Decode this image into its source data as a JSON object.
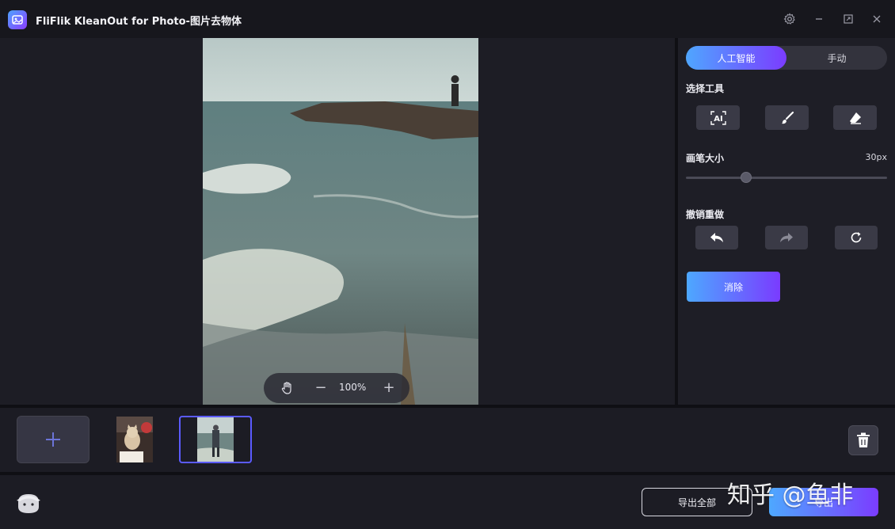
{
  "titlebar": {
    "title": "FliFlik KleanOut for Photo-图片去物体",
    "icons": [
      "settings-icon",
      "minimize-icon",
      "maximize-icon",
      "close-icon"
    ]
  },
  "canvas": {
    "zoom": {
      "hand_icon": "hand-icon",
      "minus": "−",
      "level": "100%",
      "plus": "+"
    }
  },
  "panel": {
    "mode_tabs": [
      {
        "label": "人工智能",
        "active": true
      },
      {
        "label": "手动",
        "active": false
      }
    ],
    "select_tool_label": "选择工具",
    "tools": [
      "ai-select-icon",
      "brush-icon",
      "eraser-icon"
    ],
    "brush_size_label": "画笔大小",
    "brush_size_value": "30px",
    "brush_slider_fraction": 0.3,
    "undo_redo_label": "撤销重做",
    "history_icons": [
      "undo-icon",
      "redo-icon",
      "reset-icon"
    ],
    "erase_button": "消除"
  },
  "filmstrip": {
    "add_icon": "plus-icon",
    "thumbnails": [
      {
        "name": "cat-photo",
        "selected": false
      },
      {
        "name": "beach-person-photo",
        "selected": true
      }
    ],
    "delete_icon": "trash-icon"
  },
  "footer": {
    "export_all": "导出全部",
    "export": "导出",
    "watermark": "知乎 @鱼非"
  },
  "colors": {
    "accent_start": "#4fa6ff",
    "accent_end": "#7b3cff",
    "selected_border": "#5b5bff",
    "background": "#1b1b22"
  }
}
